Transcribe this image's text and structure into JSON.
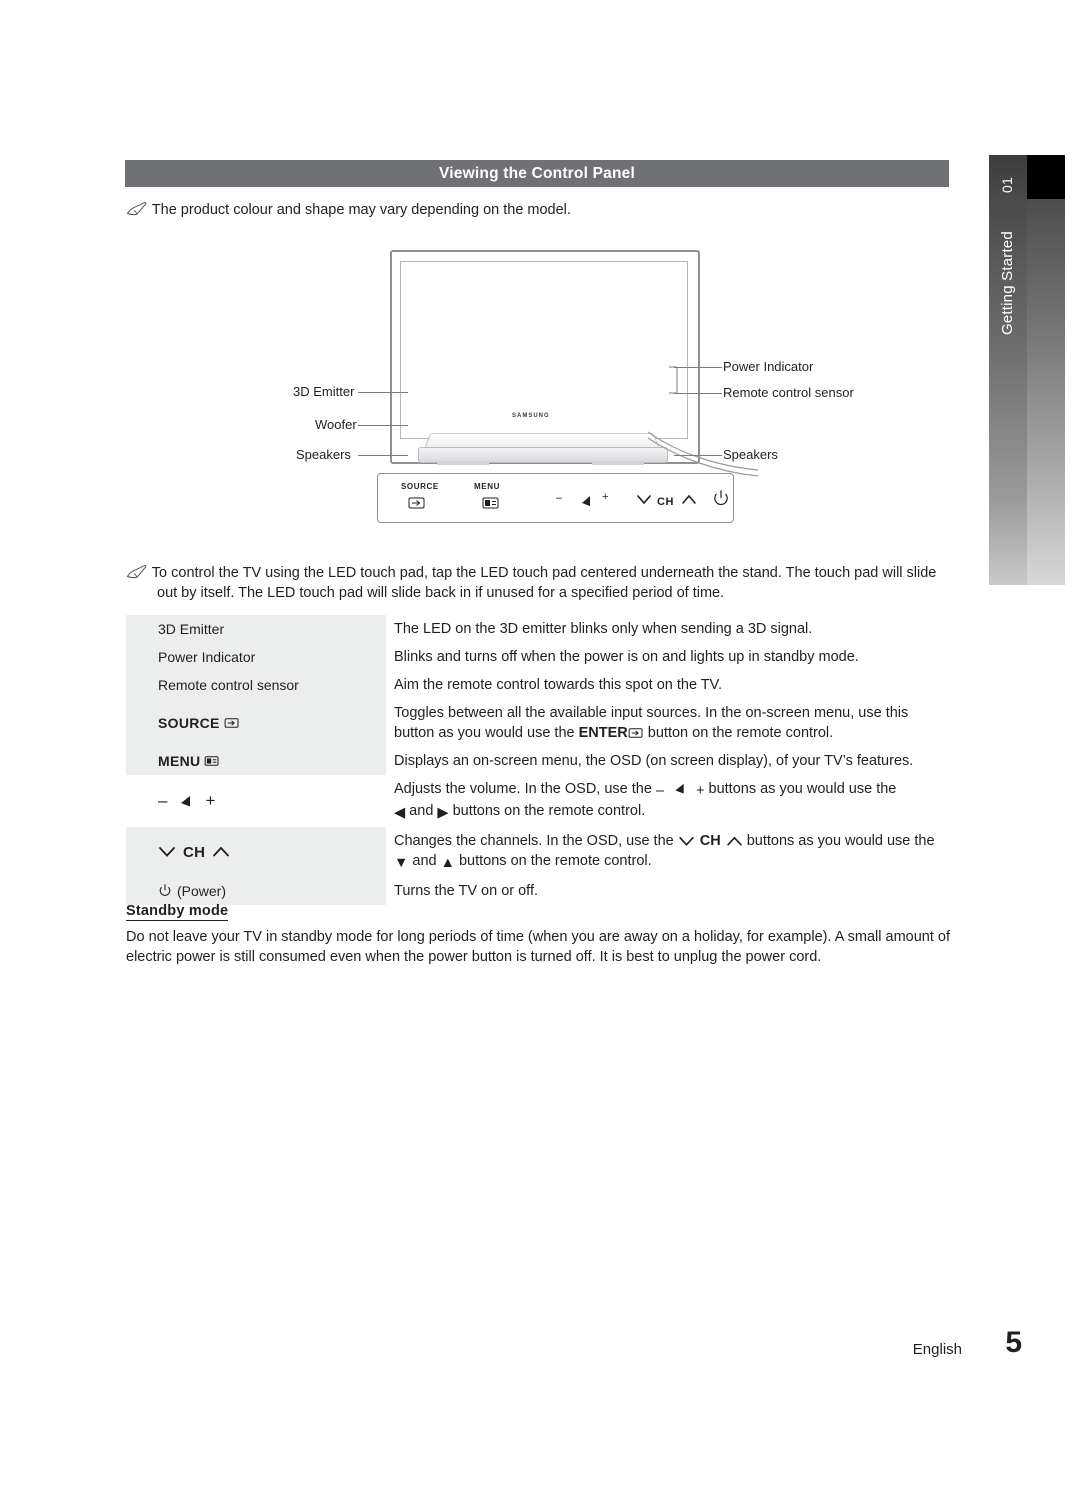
{
  "sidebar": {
    "chapter_number": "01",
    "chapter_label": "Getting Started"
  },
  "header": {
    "title": "Viewing the Control Panel"
  },
  "notes": [
    {
      "icon": "note-pencil-icon",
      "text": "The product colour and shape may vary depending on the model."
    },
    {
      "icon": "note-pencil-icon",
      "text": "To control the TV using the LED touch pad, tap the LED touch pad centered underneath the stand. The touch pad will slide out by itself. The LED touch pad will slide back in if unused for a specified period of time."
    }
  ],
  "diagram": {
    "brand": "SAMSUNG",
    "callouts_left": [
      "3D Emitter",
      "Woofer",
      "Speakers"
    ],
    "callouts_right": [
      "Power Indicator",
      "Remote control sensor",
      "Speakers"
    ],
    "touchpad": {
      "source_label": "SOURCE",
      "menu_label": "MENU",
      "volume_minus": "–",
      "volume_plus": "+",
      "channel_label": "CH"
    }
  },
  "spec_table": {
    "rows": [
      {
        "key": "3D Emitter",
        "key_type": "text",
        "value": "The LED on the 3D emitter blinks only when sending a 3D signal."
      },
      {
        "key": "Power Indicator",
        "key_type": "text",
        "value": "Blinks and turns off when the power is on and lights up in standby mode."
      },
      {
        "key": "Remote control sensor",
        "key_type": "text",
        "value": "Aim the remote control towards this spot on the TV."
      },
      {
        "key": "SOURCE",
        "key_type": "source",
        "value_part1": "Toggles between all the available input sources. In the on-screen menu, use this button as you would use the ",
        "value_bold": "ENTER",
        "value_part2": " button on the remote control."
      },
      {
        "key": "MENU",
        "key_type": "menu",
        "value": "Displays an on-screen menu, the OSD (on screen display), of your TV’s features."
      },
      {
        "key": "volume",
        "key_type": "volume",
        "value_part1": "Adjusts the volume. In the OSD, use the ",
        "value_part2": " buttons as you would use the ",
        "value_part3": " and ",
        "value_part4": " buttons on the remote control."
      },
      {
        "key": "CH",
        "key_type": "channel",
        "value_part1": "Changes the channels. In the OSD, use the ",
        "value_part2": " buttons as you would use the ",
        "value_part3": " and ",
        "value_part4": " buttons on the remote control."
      },
      {
        "key": "(Power)",
        "key_type": "power",
        "value": "Turns the TV on or off."
      }
    ]
  },
  "standby": {
    "title": "Standby mode",
    "body": "Do not leave your TV in standby mode for long periods of time (when you are away on a holiday, for example). A small amount of electric power is still consumed even when the power button is turned off. It is best to unplug the power cord."
  },
  "footer": {
    "language": "English",
    "page_number": "5"
  },
  "colors": {
    "title_bar": "#6f7174",
    "row_shade": "#eceded",
    "text": "#231f20"
  }
}
